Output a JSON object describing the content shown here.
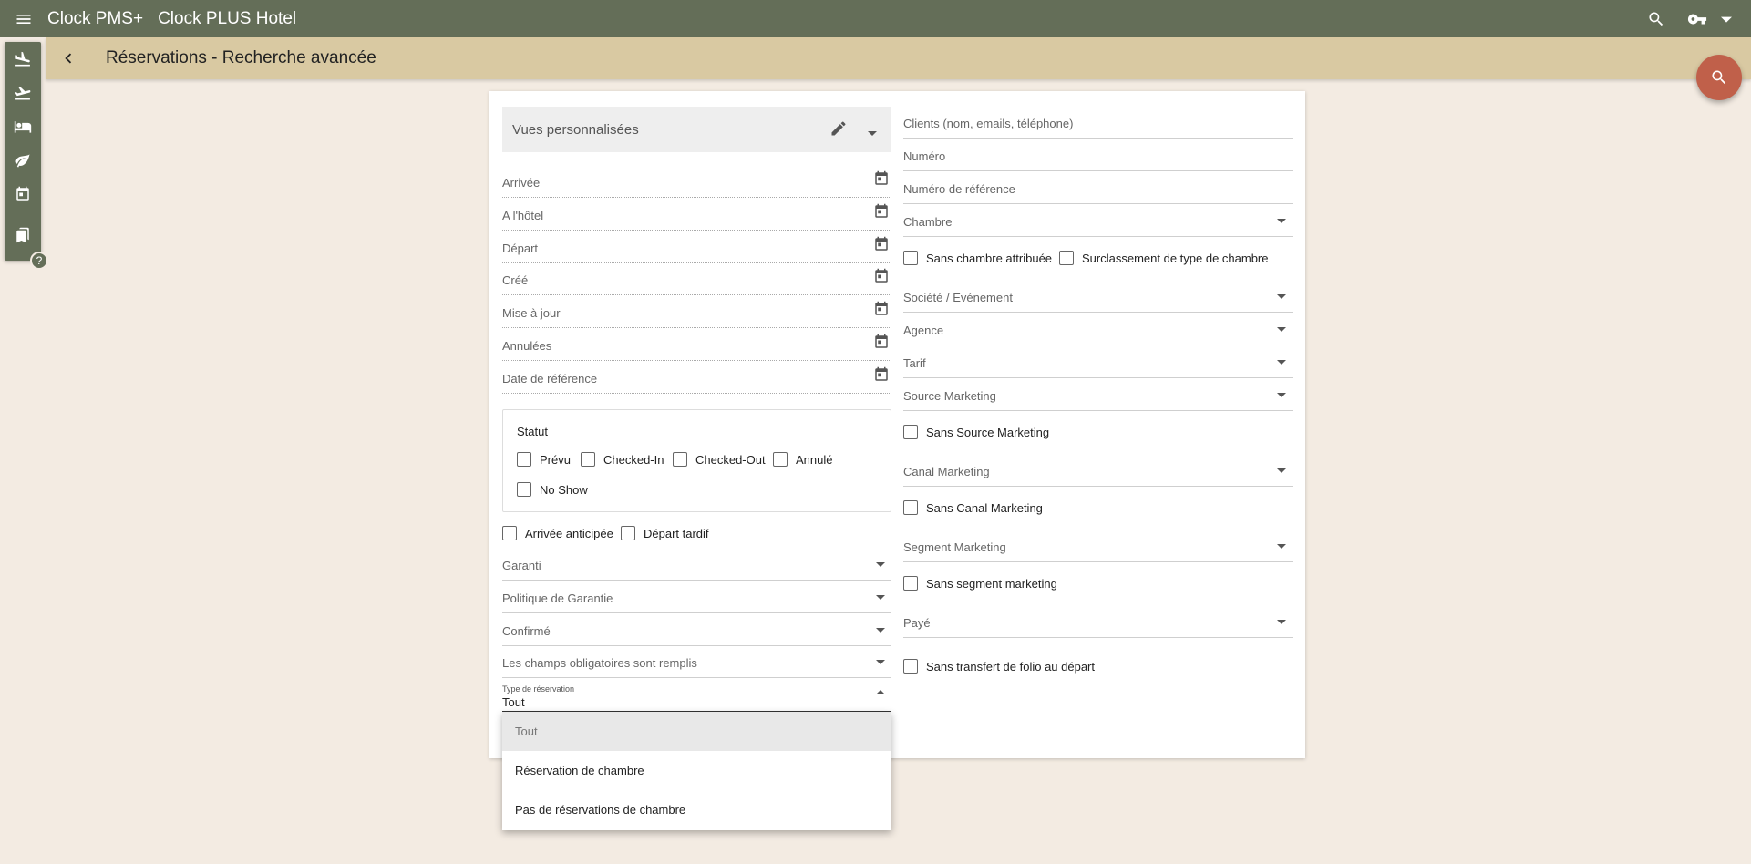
{
  "topbar": {
    "app_name": "Clock PMS+",
    "hotel_name": "Clock PLUS Hotel",
    "icons": [
      "menu-icon",
      "search-icon",
      "key-icon",
      "chevron-down-icon"
    ]
  },
  "subbar": {
    "title": "Réservations - Recherche avancée"
  },
  "sidebar": {
    "items": [
      "flight-land-icon",
      "flight-takeoff-icon",
      "bed-icon",
      "leaf-icon",
      "calendar-icon",
      "bookmark-icon"
    ],
    "help": "?"
  },
  "left": {
    "views_label": "Vues personnalisées",
    "date_fields": [
      "Arrivée",
      "A l'hôtel",
      "Départ",
      "Créé",
      "Mise à jour",
      "Annulées",
      "Date de référence"
    ],
    "status": {
      "title": "Statut",
      "options": [
        "Prévu",
        "Checked-In",
        "Checked-Out",
        "Annulé",
        "No Show"
      ]
    },
    "early_arrival": "Arrivée anticipée",
    "late_departure": "Départ tardif",
    "selects": [
      "Garanti",
      "Politique de Garantie",
      "Confirmé",
      "Les champs obligatoires sont remplis"
    ],
    "reservation_type": {
      "label": "Type de réservation",
      "value": "Tout"
    }
  },
  "right": {
    "inputs": [
      "Clients (nom, emails, téléphone)",
      "Numéro",
      "Numéro de référence"
    ],
    "room": "Chambre",
    "no_room": "Sans chambre attribuée",
    "room_upgrade": "Surclassement de type de chambre",
    "company": "Société / Evénement",
    "agency": "Agence",
    "rate": "Tarif",
    "marketing_source": "Source Marketing",
    "no_marketing_source": "Sans Source Marketing",
    "marketing_channel": "Canal Marketing",
    "no_marketing_channel": "Sans Canal Marketing",
    "marketing_segment": "Segment Marketing",
    "no_marketing_segment": "Sans segment marketing",
    "paid": "Payé",
    "no_folio_transfer": "Sans transfert de folio au départ"
  },
  "dropdown": {
    "options": [
      "Tout",
      "Réservation de chambre",
      "Pas de réservations de chambre"
    ],
    "selected": "Tout"
  },
  "colors": {
    "topbar": "#646e58",
    "subbar": "#d9c9a2",
    "background": "#f3ebe2",
    "fab": "#c0604a"
  }
}
